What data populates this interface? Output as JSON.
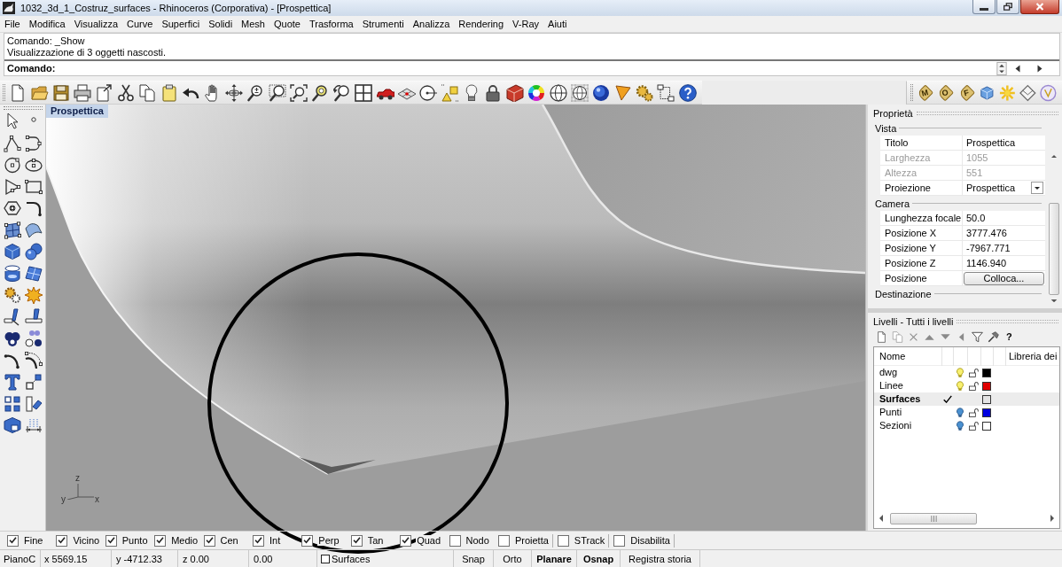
{
  "window": {
    "title": "1032_3d_1_Costruz_surfaces - Rhinoceros (Corporativa) - [Prospettica]"
  },
  "menu": [
    "File",
    "Modifica",
    "Visualizza",
    "Curve",
    "Superfici",
    "Solidi",
    "Mesh",
    "Quote",
    "Trasforma",
    "Strumenti",
    "Analizza",
    "Rendering",
    "V-Ray",
    "Aiuti"
  ],
  "command": {
    "history": [
      "Comando: _Show",
      "Visualizzazione di 3 oggetti nascosti."
    ],
    "prompt": "Comando:"
  },
  "right_toolbar": {
    "tags": [
      "M",
      "O",
      "F"
    ]
  },
  "viewport": {
    "title": "Prospettica",
    "axis_labels": [
      "z",
      "y",
      "x"
    ]
  },
  "properties": {
    "title": "Proprietà",
    "sections": [
      {
        "label": "Vista",
        "rows": [
          {
            "label": "Titolo",
            "value": "Prospettica",
            "kind": "text",
            "disabled": false
          },
          {
            "label": "Larghezza",
            "value": "1055",
            "kind": "text",
            "disabled": true
          },
          {
            "label": "Altezza",
            "value": "551",
            "kind": "text",
            "disabled": true
          },
          {
            "label": "Proiezione",
            "value": "Prospettica",
            "kind": "dropdown",
            "disabled": false
          }
        ]
      },
      {
        "label": "Camera",
        "rows": [
          {
            "label": "Lunghezza focale",
            "value": "50.0",
            "kind": "text",
            "disabled": false
          },
          {
            "label": "Posizione X",
            "value": "3777.476",
            "kind": "text",
            "disabled": false
          },
          {
            "label": "Posizione Y",
            "value": "-7967.771",
            "kind": "text",
            "disabled": false
          },
          {
            "label": "Posizione Z",
            "value": "1146.940",
            "kind": "text",
            "disabled": false
          },
          {
            "label": "Posizione",
            "value": "Colloca...",
            "kind": "button",
            "disabled": false
          }
        ]
      },
      {
        "label": "Destinazione"
      }
    ]
  },
  "layers": {
    "title": "Livelli - Tutti i livelli",
    "help": "?",
    "columns": [
      "Nome",
      "Libreria dei"
    ],
    "rows": [
      {
        "name": "dwg",
        "current": false,
        "visible": true,
        "locked": false,
        "color": "#000000"
      },
      {
        "name": "Linee",
        "current": false,
        "visible": true,
        "locked": false,
        "color": "#e00000"
      },
      {
        "name": "Surfaces",
        "current": true,
        "color": "#e4e4e4"
      },
      {
        "name": "Punti",
        "current": false,
        "visible": false,
        "locked": false,
        "color": "#0000e0"
      },
      {
        "name": "Sezioni",
        "current": false,
        "visible": false,
        "locked": false,
        "color": "#ffffff"
      }
    ]
  },
  "osnaps": [
    {
      "label": "Fine",
      "checked": true,
      "kind": "snap"
    },
    {
      "label": "Vicino",
      "checked": true,
      "kind": "snap"
    },
    {
      "label": "Punto",
      "checked": true,
      "kind": "snap"
    },
    {
      "label": "Medio",
      "checked": true,
      "kind": "snap"
    },
    {
      "label": "Cen",
      "checked": true,
      "kind": "snap"
    },
    {
      "label": "Int",
      "checked": true,
      "kind": "snap"
    },
    {
      "label": "Perp",
      "checked": true,
      "kind": "snap"
    },
    {
      "label": "Tan",
      "checked": true,
      "kind": "snap"
    },
    {
      "label": "Quad",
      "checked": true,
      "kind": "snap"
    },
    {
      "label": "Nodo",
      "checked": false,
      "kind": "snap"
    },
    {
      "label": "Proietta",
      "checked": false,
      "kind": "mode"
    },
    {
      "label": "STrack",
      "checked": false,
      "kind": "mode"
    },
    {
      "label": "Disabilita",
      "checked": false,
      "kind": "mode"
    }
  ],
  "status_bar": {
    "plane": "PianoC",
    "x": "x 5569.15",
    "y": "y -4712.33",
    "z": "z 0.00",
    "distance": "0.00",
    "layer": "Surfaces",
    "toggles": [
      {
        "label": "Snap",
        "on": false
      },
      {
        "label": "Orto",
        "on": false
      },
      {
        "label": "Planare",
        "on": true
      },
      {
        "label": "Osnap",
        "on": true
      },
      {
        "label": "Registra storia",
        "on": false
      }
    ]
  }
}
